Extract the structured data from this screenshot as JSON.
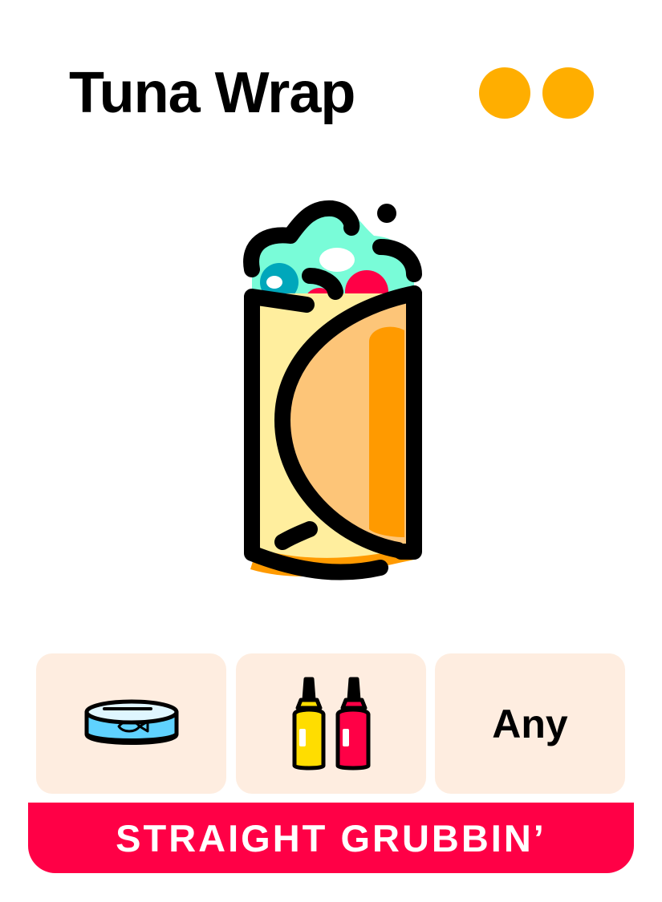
{
  "card": {
    "title": "Tuna Wrap",
    "rating_dots": 2
  },
  "illustration": {
    "icon": "burrito-wrap-icon"
  },
  "tiles": [
    {
      "icon": "tuna-can-icon"
    },
    {
      "icon": "condiment-bottles-icon"
    },
    {
      "label": "Any"
    }
  ],
  "banner": {
    "label": "STRAIGHT GRUBBIN’"
  },
  "colors": {
    "background": "#ffffff",
    "dot": "#FFAE00",
    "tile": "#FEEDE0",
    "banner": "#FF0046",
    "banner_text": "#ffffff",
    "outline": "#000000",
    "tortilla_light": "#FFEE9E",
    "tortilla_mid": "#FDC578",
    "tortilla_dark": "#FF9A00",
    "lettuce": "#79FCD8",
    "filling_teal": "#00A7BB",
    "filling_red": "#FF0046",
    "can_blue": "#5FD2FF",
    "mustard": "#FFDD00"
  }
}
